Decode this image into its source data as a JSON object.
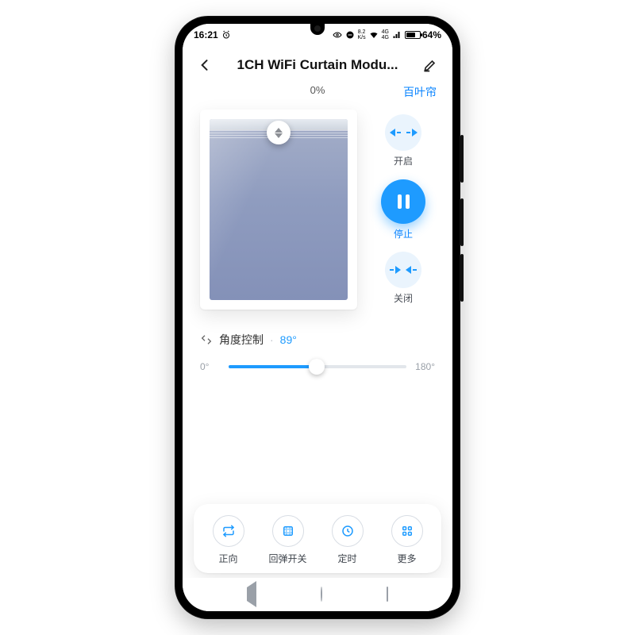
{
  "status": {
    "time": "16:21",
    "net_speed_top": "8.2",
    "net_speed_bottom": "K/s",
    "net_type_top": "4G",
    "net_type_bottom": "4G",
    "battery": "64%"
  },
  "header": {
    "title": "1CH WiFi Curtain Modu..."
  },
  "curtain": {
    "percent": "0%",
    "type_label": "百叶帘"
  },
  "controls": {
    "open": "开启",
    "stop": "停止",
    "close": "关闭",
    "active": "stop"
  },
  "angle": {
    "label": "角度控制",
    "value": "89°",
    "min": "0°",
    "max": "180°",
    "current": 89,
    "range_max": 180
  },
  "actions": [
    {
      "id": "direction",
      "label": "正向"
    },
    {
      "id": "rebound",
      "label": "回弹开关"
    },
    {
      "id": "timer",
      "label": "定时"
    },
    {
      "id": "more",
      "label": "更多"
    }
  ],
  "colors": {
    "accent": "#1e9bff",
    "accent_soft": "#eaf4fd"
  }
}
